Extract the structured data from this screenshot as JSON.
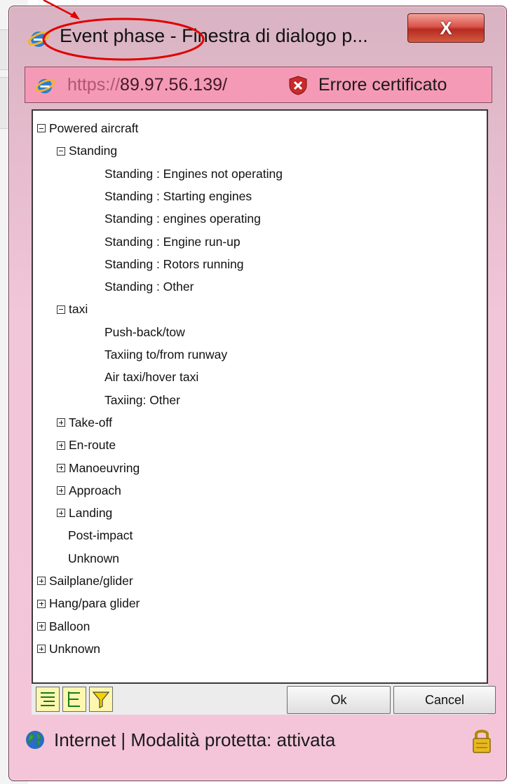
{
  "window": {
    "title": "Event phase - Finestra di dialogo p...",
    "close_label": "X"
  },
  "address": {
    "scheme": "https://",
    "host": "89.97.56.139/",
    "cert_error": "Errore certificato"
  },
  "tree": [
    {
      "label": "Powered aircraft",
      "level": 0,
      "toggle": "minus"
    },
    {
      "label": "Standing",
      "level": 1,
      "toggle": "minus"
    },
    {
      "label": "Standing : Engines not operating",
      "level": 2
    },
    {
      "label": "Standing : Starting engines",
      "level": 2
    },
    {
      "label": "Standing : engines operating",
      "level": 2
    },
    {
      "label": "Standing : Engine run-up",
      "level": 2
    },
    {
      "label": "Standing : Rotors running",
      "level": 2
    },
    {
      "label": "Standing : Other",
      "level": 2
    },
    {
      "label": "taxi",
      "level": 1,
      "toggle": "minus"
    },
    {
      "label": "Push-back/tow",
      "level": 2
    },
    {
      "label": "Taxiing to/from runway",
      "level": 2
    },
    {
      "label": "Air taxi/hover taxi",
      "level": 2
    },
    {
      "label": "Taxiing: Other",
      "level": 2
    },
    {
      "label": "Take-off",
      "level": 1,
      "toggle": "plus"
    },
    {
      "label": "En-route",
      "level": 1,
      "toggle": "plus"
    },
    {
      "label": "Manoeuvring",
      "level": 1,
      "toggle": "plus"
    },
    {
      "label": "Approach",
      "level": 1,
      "toggle": "plus"
    },
    {
      "label": "Landing",
      "level": 1,
      "toggle": "plus"
    },
    {
      "label": "Post-impact",
      "level": 1,
      "toggle": "none"
    },
    {
      "label": "Unknown",
      "level": 1,
      "toggle": "none"
    },
    {
      "label": "Sailplane/glider",
      "level": 0,
      "toggle": "plus"
    },
    {
      "label": "Hang/para glider",
      "level": 0,
      "toggle": "plus"
    },
    {
      "label": "Balloon",
      "level": 0,
      "toggle": "plus"
    },
    {
      "label": "Unknown",
      "level": 0,
      "toggle": "plus"
    }
  ],
  "toolbar": {
    "ok_label": "Ok",
    "cancel_label": "Cancel",
    "icons": [
      "expand-all-icon",
      "collapse-tree-icon",
      "filter-icon"
    ]
  },
  "status": {
    "text": "Internet | Modalità protetta: attivata"
  },
  "colors": {
    "frame": "#f4c5d8",
    "address_bar": "#f59ab6",
    "close_button": "#d9534a",
    "annotation": "#e00000"
  }
}
